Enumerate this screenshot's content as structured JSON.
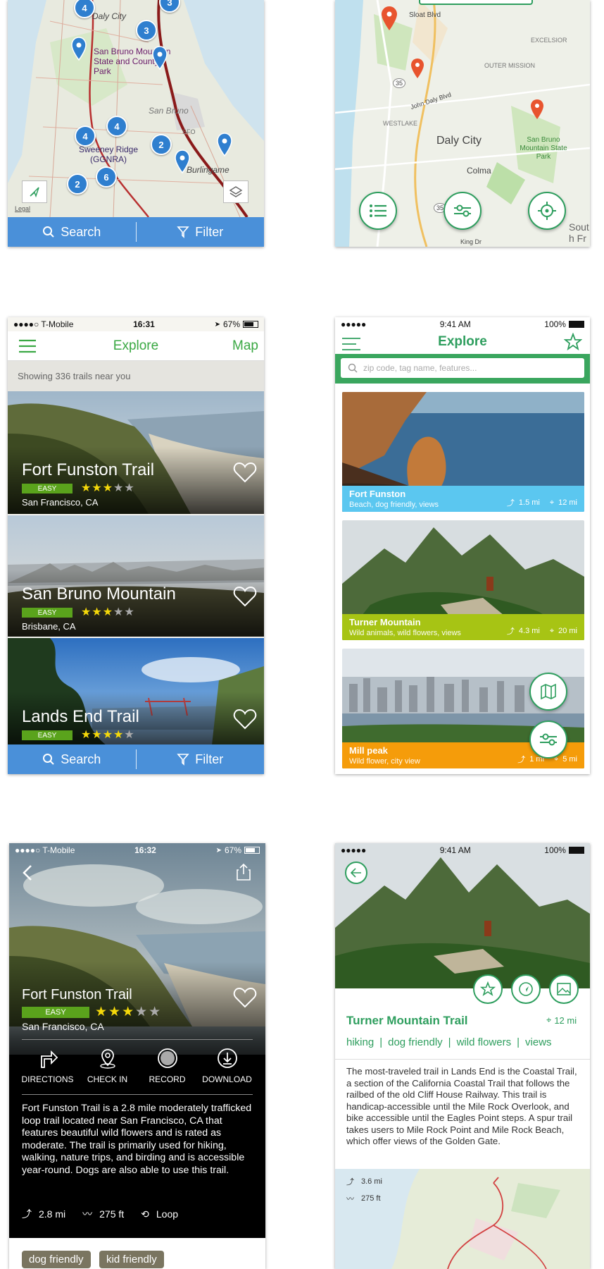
{
  "map_screen_1": {
    "places": [
      "Daly City",
      "San Bruno Mountain State and County Park",
      "San Bruno",
      "SFO",
      "Sweeney Ridge (GGNRA)",
      "Burlingame"
    ],
    "clusters": [
      "4",
      "3",
      "3",
      "4",
      "4",
      "2",
      "2",
      "6"
    ],
    "legal": "Legal",
    "search_label": "Search",
    "filter_label": "Filter"
  },
  "map_screen_2": {
    "places": [
      "Sloat Blvd",
      "EXCELSIOR",
      "OUTER MISSION",
      "John Daly Blvd",
      "WESTLAKE",
      "Daly City",
      "San Bruno Mountain State Park",
      "Colma",
      "South Fran",
      "King Dr"
    ],
    "route_numbers": [
      "35",
      "35"
    ]
  },
  "list_screen": {
    "status": {
      "carrier": "●●●●○ T-Mobile",
      "time": "16:31",
      "battery": "67%"
    },
    "title": "Explore",
    "map_link": "Map",
    "summary": "Showing 336 trails near you",
    "trails": [
      {
        "name": "Fort Funston Trail",
        "difficulty": "EASY",
        "stars": 3,
        "location": "San Francisco, CA"
      },
      {
        "name": "San Bruno Mountain",
        "difficulty": "EASY",
        "stars": 3,
        "location": "Brisbane, CA"
      },
      {
        "name": "Lands End Trail",
        "difficulty": "EASY",
        "stars": 4,
        "location": ""
      }
    ],
    "search_label": "Search",
    "filter_label": "Filter",
    "accent": "#3aa843",
    "bar_color": "#4a90d9"
  },
  "explore_screen": {
    "status": {
      "carrier": "●●●●●",
      "time": "9:41 AM",
      "battery": "100%"
    },
    "title": "Explore",
    "search_placeholder": "zip code, tag name, features...",
    "cards": [
      {
        "name": "Fort Funston",
        "tags": "Beach, dog friendly, views",
        "length": "1.5 mi",
        "distance": "12 mi",
        "color": "#5bc7f0"
      },
      {
        "name": "Turner Mountain",
        "tags": "Wild animals, wild flowers, views",
        "length": "4.3 mi",
        "distance": "20 mi",
        "color": "#a7c414"
      },
      {
        "name": "Mill peak",
        "tags": "Wild flower, city view",
        "length": "1 mi",
        "distance": "5 mi",
        "color": "#f59c0a"
      }
    ],
    "accent": "#2e9e5e"
  },
  "detail_screen": {
    "status": {
      "carrier": "●●●●○ T-Mobile",
      "time": "16:32",
      "battery": "67%"
    },
    "name": "Fort Funston Trail",
    "difficulty": "EASY",
    "stars": 3,
    "location": "San Francisco, CA",
    "actions": [
      "DIRECTIONS",
      "CHECK IN",
      "RECORD",
      "DOWNLOAD"
    ],
    "description": "Fort Funston Trail is a 2.8 mile moderately trafficked loop trail located near San Francisco, CA that features beautiful wild flowers and is rated as moderate. The trail is primarily used for hiking, walking, nature trips, and birding and is accessible year-round. Dogs are also able to use this trail.",
    "length": "2.8 mi",
    "elevation": "275 ft",
    "route_type": "Loop",
    "tags": [
      "dog friendly",
      "kid friendly"
    ]
  },
  "turner_screen": {
    "status": {
      "carrier": "●●●●●",
      "time": "9:41 AM",
      "battery": "100%"
    },
    "name": "Turner Mountain Trail",
    "distance": "12 mi",
    "tags": [
      "hiking",
      "dog friendly",
      "wild flowers",
      "views"
    ],
    "separator": "|",
    "description": "The most-traveled trail in Lands End is the Coastal Trail, a section of the California Coastal Trail that follows the railbed of the old Cliff House Railway. This trail is handicap-accessible until the Mile Rock Overlook, and bike accessible until the Eagles Point steps. A spur trail takes users to Mile Rock Point and Mile Rock Beach, which offer views of the Golden Gate.",
    "length": "3.6 mi",
    "elevation": "275 ft"
  }
}
